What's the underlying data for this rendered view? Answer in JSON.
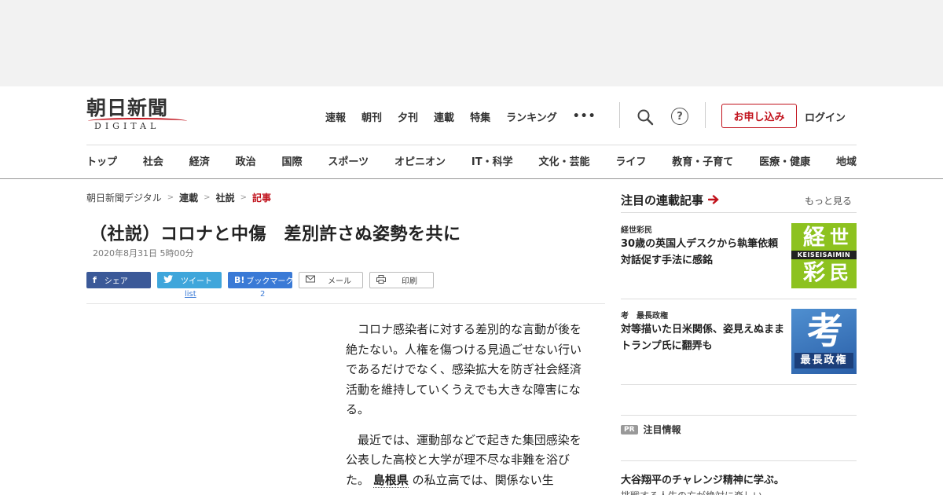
{
  "logo": {
    "main": "朝日新聞",
    "sub": "DIGITAL"
  },
  "top_nav": [
    "速報",
    "朝刊",
    "夕刊",
    "連載",
    "特集",
    "ランキング"
  ],
  "header": {
    "subscribe_label": "お申し込み",
    "login_label": "ログイン",
    "help_glyph": "?"
  },
  "category_nav": [
    "トップ",
    "社会",
    "経済",
    "政治",
    "国際",
    "スポーツ",
    "オピニオン",
    "IT・科学",
    "文化・芸能",
    "ライフ",
    "教育・子育て",
    "医療・健康",
    "地域"
  ],
  "breadcrumb": [
    "朝日新聞デジタル",
    "連載",
    "社説",
    "記事"
  ],
  "article": {
    "title": "（社説）コロナと中傷　差別許さぬ姿勢を共に",
    "date": "2020年8月31日 5時00分",
    "paragraphs": [
      "コロナ感染者に対する差別的な言動が後を絶たない。人権を傷つける見過ごせない行いであるだけでなく、感染拡大を防ぎ社会経済活動を維持していくうえでも大きな障害になる。",
      "最近では、運動部などで起きた集団感染を公表した高校と大学が理不尽な非難を浴びた。"
    ],
    "p2_keyword": "島根県",
    "p2_after": "の私立高では、関係ない生"
  },
  "share": {
    "facebook": "シェア",
    "twitter": "ツイート",
    "twitter_count": "list",
    "hatena_icon": "B!",
    "hatena": "ブックマーク",
    "hatena_count": "2",
    "mail": "メール",
    "print": "印刷"
  },
  "sidebar": {
    "title": "注目の連載記事",
    "more": "もっと見る",
    "items": [
      {
        "label": "経世彩民",
        "text": "30歳の英国人デスクから執筆依頼　対話促す手法に感銘",
        "thumb_en": "KEISEISAIMIN"
      },
      {
        "label": "考　最長政権",
        "text": "対等描いた日米関係、姿見えぬまま　トランプ氏に翻弄も",
        "thumb_big": "考",
        "thumb_band": "最長政権"
      }
    ],
    "pr_badge": "PR",
    "pr_label": "注目情報",
    "pr_headline": "大谷翔平のチャレンジ精神に学ぶ。",
    "pr_sub": "挑戦する人生の方が絶対に楽しい"
  },
  "colors": {
    "brand_red": "#c1121c",
    "facebook": "#3b5998",
    "twitter": "#3fa6db",
    "hatena": "#3a7ad6",
    "thumb_green": "#8dc21f",
    "thumb_blue": "#2a5fa8"
  }
}
